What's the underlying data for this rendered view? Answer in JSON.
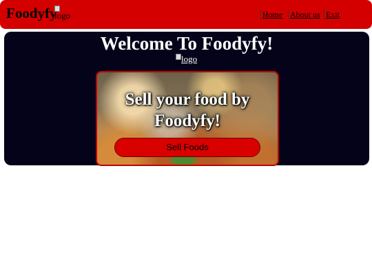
{
  "navbar": {
    "brand": "Foodyfy",
    "logo_alt": "logo",
    "links": [
      {
        "label": "Home"
      },
      {
        "label": "About us"
      },
      {
        "label": "Exit"
      }
    ]
  },
  "hero": {
    "title": "Welcome To Foodyfy!",
    "logo_alt": "logo",
    "card": {
      "title": "Sell your food by Foodyfy!",
      "button_label": "Sell Foods"
    }
  },
  "colors": {
    "navbar_bg": "#d40000",
    "hero_bg": "#04031a",
    "button_bg": "#d90000"
  }
}
